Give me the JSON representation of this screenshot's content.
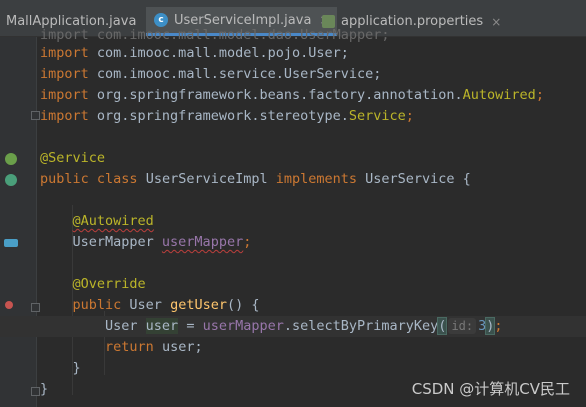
{
  "tabs": [
    {
      "label": "MallApplication.java",
      "active": false
    },
    {
      "label": "UserServiceImpl.java",
      "active": true
    },
    {
      "label": "application.properties",
      "active": false
    }
  ],
  "tab_close": "×",
  "tab_class_icon": "c",
  "code": {
    "line0_partial": "import com.imooc.mall.model.dao.UserMapper;",
    "line1": {
      "kw": "import",
      "rest": " com.imooc.mall.model.pojo.User;"
    },
    "line2": {
      "kw": "import",
      "rest": " com.imooc.mall.service.UserService;"
    },
    "line3": {
      "kw": "import",
      "rest": " org.springframework.beans.factory.annotation.",
      "tail": "Autowired",
      "end": ";"
    },
    "line4": {
      "kw": "import",
      "rest": " org.springframework.stereotype.",
      "tail": "Service",
      "end": ";"
    },
    "line5": {
      "ann": "@Service"
    },
    "line6": {
      "kw1": "public",
      "kw2": "class",
      "name": " UserServiceImpl ",
      "kw3": "implements",
      "rest": " UserService {"
    },
    "line7": {
      "ann": "@Autowired"
    },
    "line8": {
      "type": "UserMapper ",
      "field": "userMapper",
      "end": ";"
    },
    "line9": {
      "ann": "@Override"
    },
    "line10": {
      "kw": "public",
      "type": " User ",
      "fn": "getUser",
      "rest": "() {"
    },
    "line11": {
      "type": "User ",
      "var": "user",
      "eq": " = ",
      "field": "userMapper",
      "call": ".selectByPrimaryKey",
      "open": "(",
      "hint": "id:",
      "num": "3",
      "close": ")",
      "end": ";"
    },
    "line12": {
      "kw": "return",
      "rest": " user;"
    },
    "line13": "}",
    "line14": "}"
  },
  "watermark": "CSDN @计算机CV民工",
  "colors": {
    "keyword": "#cc7832",
    "annotation": "#bbb529",
    "field": "#9876aa",
    "method": "#ffc66d",
    "number": "#6897bb",
    "text": "#a9b7c6",
    "background": "#2b2b2b"
  }
}
